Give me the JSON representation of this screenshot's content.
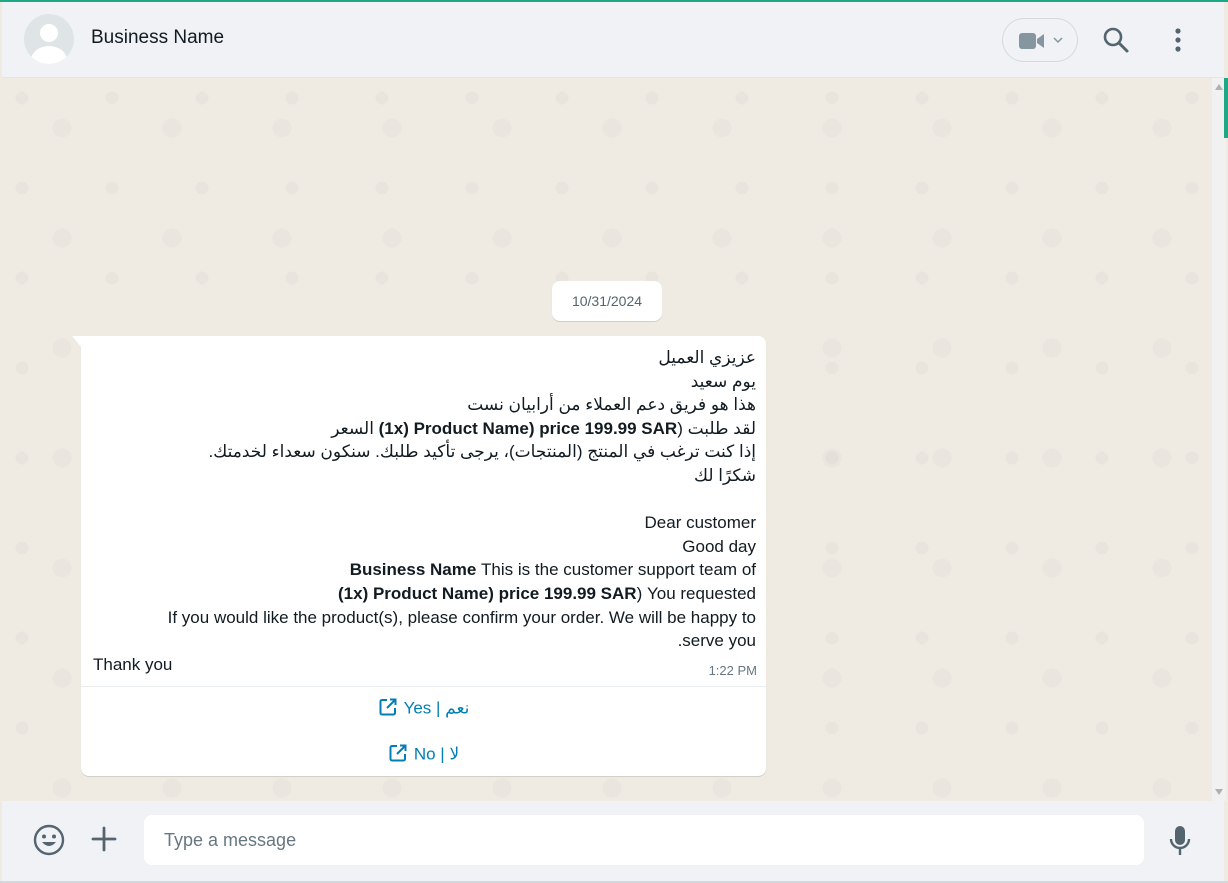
{
  "header": {
    "contact_name": "Business Name",
    "avatar_icon": "default-user-avatar-icon",
    "video_call_icon": "video-camera-icon",
    "video_dropdown_icon": "chevron-down-icon",
    "search_icon": "search-icon",
    "menu_icon": "more-vertical-icon"
  },
  "chat": {
    "date_label": "10/31/2024",
    "message": {
      "lines": [
        {
          "text": "عزيزي العميل"
        },
        {
          "text": "يوم سعيد"
        },
        {
          "text": "هذا هو فريق دعم العملاء من أرابيان نست"
        },
        {
          "prefix": "لقد طلبت (",
          "bold": "(1x) Product Name) price 199.99 SAR",
          "suffix": " السعر"
        },
        {
          "text": "إذا كنت ترغب في المنتج (المنتجات)، يرجى تأكيد طلبك. سنكون سعداء لخدمتك."
        },
        {
          "text": "شكرًا لك"
        },
        {
          "text": ""
        },
        {
          "text": "Dear customer"
        },
        {
          "text": "Good day"
        },
        {
          "prefix": "This is the customer support team of ",
          "bold": "Business Name"
        },
        {
          "prefix": "You requested (",
          "bold": "(1x) Product Name) price 199.99 SAR"
        },
        {
          "text": "If you would like the product(s), please confirm your order. We will be happy to"
        },
        {
          "text": "serve you."
        },
        {
          "text": "Thank you",
          "align": "left"
        }
      ],
      "time": "1:22 PM"
    },
    "actions": [
      {
        "label": "Yes | نعم",
        "icon": "external-link-icon"
      },
      {
        "label": "No | لا",
        "icon": "external-link-icon"
      }
    ]
  },
  "composer": {
    "emoji_icon": "emoji-smile-icon",
    "attach_icon": "plus-icon",
    "placeholder": "Type a message",
    "value": "",
    "mic_icon": "microphone-icon"
  },
  "colors": {
    "accent": "#1fa885",
    "link": "#027eb5",
    "chat_background": "#efeae2",
    "panel_background": "#f0f2f5"
  }
}
